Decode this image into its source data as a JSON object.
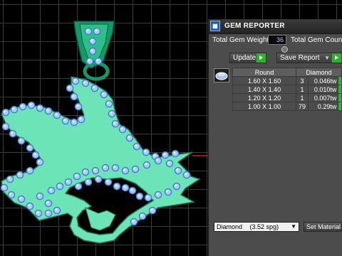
{
  "panel": {
    "title": "GEM REPORTER",
    "app_icon": "grid-app-icon",
    "total_weight_label": "Total Gem Weight",
    "total_weight_value": "36",
    "total_count_label": "Total Gem Count",
    "update_label": "Update",
    "save_report_label": "Save Report",
    "table": {
      "headers": [
        "Round",
        "Diamond"
      ],
      "rows": [
        {
          "size": "1.60 X 1.60",
          "count": "3",
          "weight": "0.046tw"
        },
        {
          "size": "1.40 X 1.40",
          "count": "1",
          "weight": "0.010tw"
        },
        {
          "size": "1.20 X 1.20",
          "count": "1",
          "weight": "0.007tw"
        },
        {
          "size": "1.00 X 1.00",
          "count": "79",
          "weight": "0.29tw"
        }
      ]
    },
    "material_select_value": "Diamond",
    "material_select_spg": "(3.52 spg)",
    "set_material_label": "Set Material"
  },
  "colors": {
    "metal": "#6de3b8",
    "metal_outline": "#1d7a55",
    "gem": "#a9cdf6",
    "gem_ring": "#3e7fd0",
    "grid": "#3a3a3a",
    "axis": "#c81e1e",
    "bail": "#129a6a"
  }
}
